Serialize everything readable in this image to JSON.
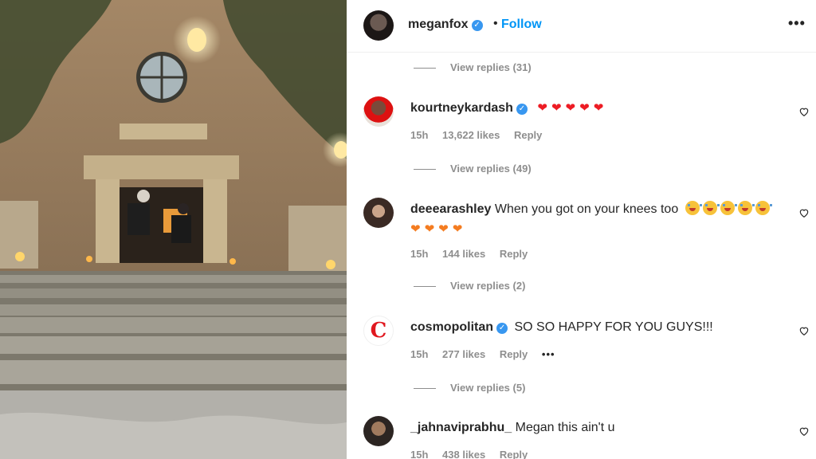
{
  "post": {
    "author": "meganfox",
    "follow_label": "Follow",
    "dot": "•",
    "more_label": "•••"
  },
  "replies": [
    {
      "label": "View replies (31)"
    },
    {
      "label": "View replies (49)"
    },
    {
      "label": "View replies (2)"
    },
    {
      "label": "View replies (5)"
    }
  ],
  "comments": [
    {
      "username": "kourtneykardash",
      "verified": true,
      "text": "",
      "time": "15h",
      "likes": "13,622 likes",
      "reply": "Reply"
    },
    {
      "username": "deeearashley",
      "verified": false,
      "text": "When you got on your knees too",
      "time": "15h",
      "likes": "144 likes",
      "reply": "Reply"
    },
    {
      "username": "cosmopolitan",
      "verified": true,
      "text": "SO SO HAPPY FOR YOU GUYS!!!",
      "time": "15h",
      "likes": "277 likes",
      "reply": "Reply",
      "more": "•••",
      "logo_letter": "C"
    },
    {
      "username": "_jahnaviprabhu_",
      "verified": false,
      "text": "Megan this ain't u",
      "time": "15h",
      "likes": "438 likes",
      "reply": "Reply"
    }
  ],
  "verified_glyph": "✓",
  "colors": {
    "link": "#0095f6",
    "verified": "#3897f0",
    "meta": "#8e8e8e"
  }
}
